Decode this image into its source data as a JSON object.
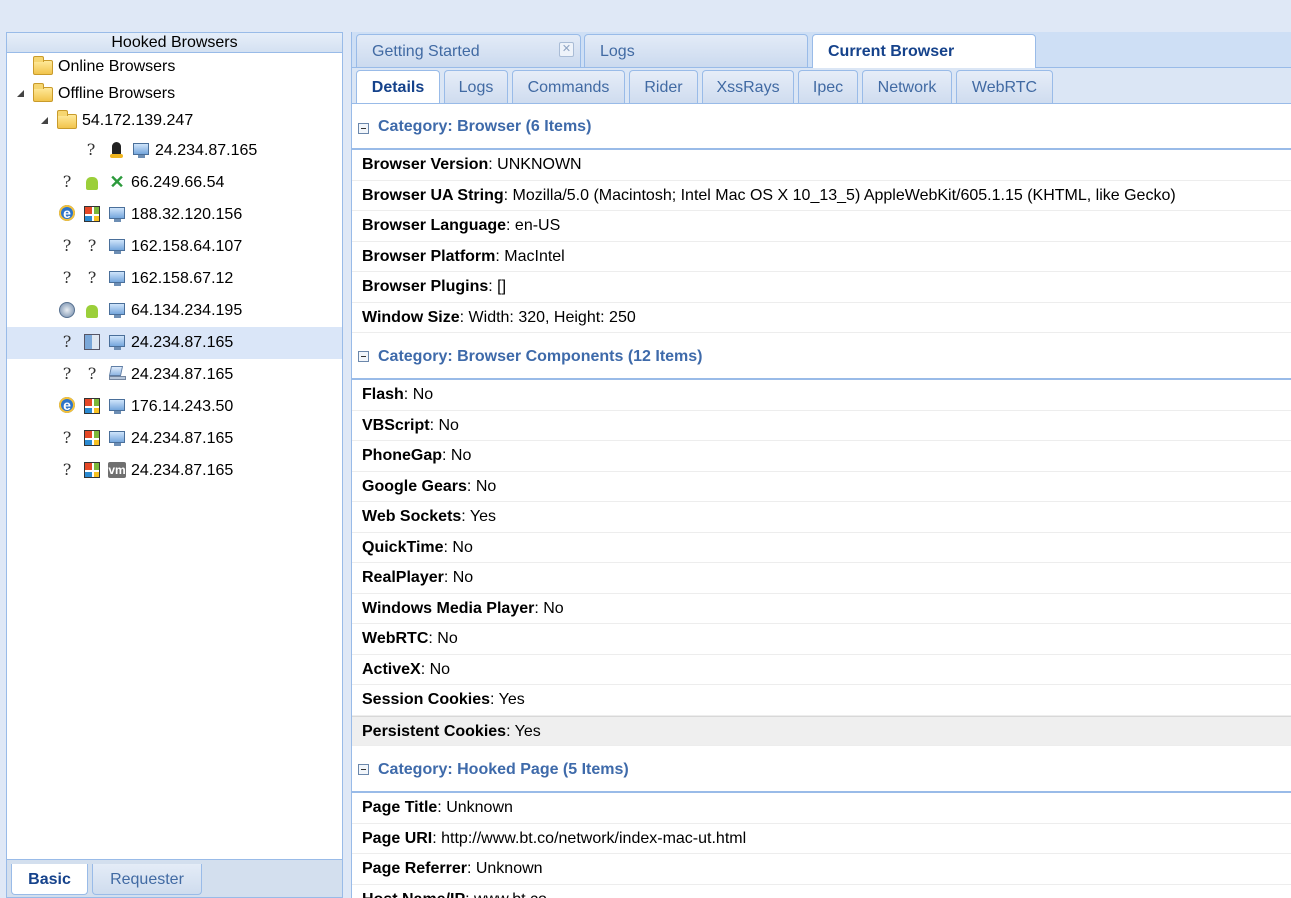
{
  "left_panel": {
    "title": "Hooked Browsers",
    "tree": {
      "online_label": "Online Browsers",
      "offline_label": "Offline Browsers",
      "subnet_label": "54.172.139.247",
      "subnet_child": {
        "icons": [
          "unknown-browser-icon",
          "linux-icon",
          "desktop-icon"
        ],
        "label": "24.234.87.165"
      },
      "offline_items": [
        {
          "icons": [
            "unknown-browser-icon",
            "android-icon",
            "x-icon"
          ],
          "label": "66.249.66.54"
        },
        {
          "icons": [
            "internet-explorer-icon",
            "windows-icon",
            "desktop-icon"
          ],
          "label": "188.32.120.156"
        },
        {
          "icons": [
            "unknown-browser-icon",
            "unknown-os-icon",
            "desktop-icon"
          ],
          "label": "162.158.64.107"
        },
        {
          "icons": [
            "unknown-browser-icon",
            "unknown-os-icon",
            "desktop-icon"
          ],
          "label": "162.158.67.12"
        },
        {
          "icons": [
            "safari-icon",
            "android-icon",
            "desktop-icon"
          ],
          "label": "64.134.234.195"
        },
        {
          "icons": [
            "unknown-browser-icon",
            "macos-icon",
            "desktop-icon"
          ],
          "label": "24.234.87.165",
          "selected": true
        },
        {
          "icons": [
            "unknown-browser-icon",
            "unknown-os-icon",
            "laptop-icon"
          ],
          "label": "24.234.87.165"
        },
        {
          "icons": [
            "internet-explorer-icon",
            "windows-icon",
            "desktop-icon"
          ],
          "label": "176.14.243.50"
        },
        {
          "icons": [
            "unknown-browser-icon",
            "windows-icon",
            "desktop-icon"
          ],
          "label": "24.234.87.165"
        },
        {
          "icons": [
            "unknown-browser-icon",
            "windows-icon",
            "vm-icon"
          ],
          "label": "24.234.87.165"
        }
      ]
    },
    "bottom_tabs": {
      "basic": "Basic",
      "requester": "Requester"
    }
  },
  "top_tabs": {
    "getting_started": "Getting Started",
    "logs": "Logs",
    "current_browser": "Current Browser",
    "close_glyph": "✕"
  },
  "sub_tabs": [
    "Details",
    "Logs",
    "Commands",
    "Rider",
    "XssRays",
    "Ipec",
    "Network",
    "WebRTC"
  ],
  "details": {
    "categories": [
      {
        "title": "Category: Browser (6 Items)",
        "rows": [
          {
            "key": "Browser Version",
            "value": ": UNKNOWN"
          },
          {
            "key": "Browser UA String",
            "value": ": Mozilla/5.0 (Macintosh; Intel Mac OS X 10_13_5) AppleWebKit/605.1.15 (KHTML, like Gecko)"
          },
          {
            "key": "Browser Language",
            "value": ": en-US"
          },
          {
            "key": "Browser Platform",
            "value": ": MacIntel"
          },
          {
            "key": "Browser Plugins",
            "value": ": []"
          },
          {
            "key": "Window Size",
            "value": ": Width: 320, Height: 250"
          }
        ]
      },
      {
        "title": "Category: Browser Components (12 Items)",
        "rows": [
          {
            "key": "Flash",
            "value": ": No"
          },
          {
            "key": "VBScript",
            "value": ": No"
          },
          {
            "key": "PhoneGap",
            "value": ": No"
          },
          {
            "key": "Google Gears",
            "value": ": No"
          },
          {
            "key": "Web Sockets",
            "value": ": Yes"
          },
          {
            "key": "QuickTime",
            "value": ": No"
          },
          {
            "key": "RealPlayer",
            "value": ": No"
          },
          {
            "key": "Windows Media Player",
            "value": ": No"
          },
          {
            "key": "WebRTC",
            "value": ": No"
          },
          {
            "key": "ActiveX",
            "value": ": No"
          },
          {
            "key": "Session Cookies",
            "value": ": Yes"
          },
          {
            "key": "Persistent Cookies",
            "value": ": Yes",
            "highlighted": true
          }
        ]
      },
      {
        "title": "Category: Hooked Page (5 Items)",
        "rows": [
          {
            "key": "Page Title",
            "value": ": Unknown"
          },
          {
            "key": "Page URI",
            "value": ": http://www.bt.co/network/index-mac-ut.html"
          },
          {
            "key": "Page Referrer",
            "value": ": Unknown"
          },
          {
            "key": "Host Name/IP",
            "value": ": www.bt.co"
          }
        ]
      }
    ]
  },
  "colors": {
    "accent": "#15428b",
    "border": "#99bbe8",
    "category_text": "#3e6aaa",
    "selected_row": "#dae6f8"
  }
}
